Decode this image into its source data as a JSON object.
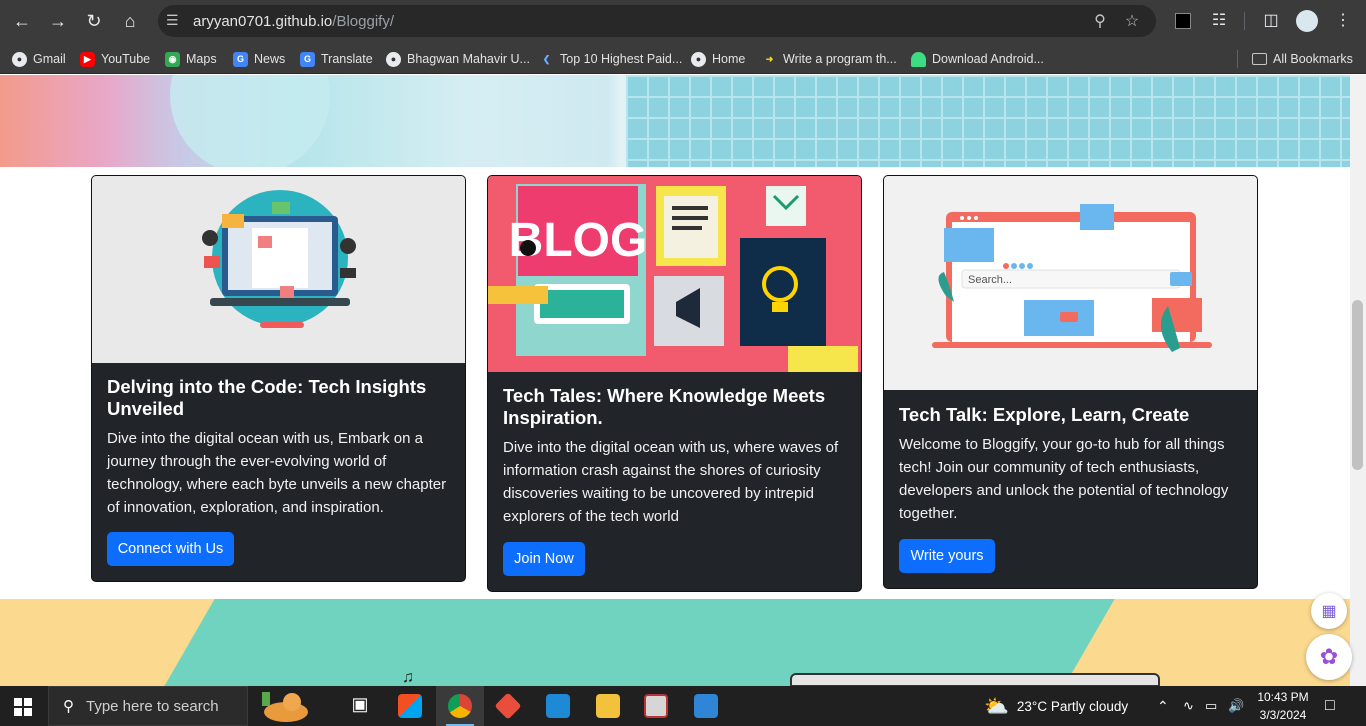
{
  "browser": {
    "url_host": "aryyan0701.github.io",
    "url_path": "/Bloggify/",
    "bookmarks": [
      {
        "label": "Gmail",
        "icon": "globe-icon"
      },
      {
        "label": "YouTube",
        "icon": "youtube-icon"
      },
      {
        "label": "Maps",
        "icon": "maps-icon"
      },
      {
        "label": "News",
        "icon": "news-icon"
      },
      {
        "label": "Translate",
        "icon": "translate-icon"
      },
      {
        "label": "Bhagwan Mahavir U...",
        "icon": "globe-icon"
      },
      {
        "label": "Top 10 Highest Paid...",
        "icon": "bookmark-icon"
      },
      {
        "label": "Home",
        "icon": "globe-icon"
      },
      {
        "label": "Write a program th...",
        "icon": "bolt-icon"
      },
      {
        "label": "Download Android...",
        "icon": "android-icon"
      }
    ],
    "all_bookmarks": "All Bookmarks"
  },
  "cards": [
    {
      "title": "Delving into the Code: Tech Insights Unveiled",
      "text": "Dive into the digital ocean with us, Embark on a journey through the ever-evolving world of technology, where each byte unveils a new chapter of innovation, exploration, and inspiration.",
      "button": "Connect with Us"
    },
    {
      "title": "Tech Tales: Where Knowledge Meets Inspiration.",
      "text": "Dive into the digital ocean with us, where waves of information crash against the shores of curiosity discoveries waiting to be uncovered by intrepid explorers of the tech world",
      "button": "Join Now",
      "image_text": "BLOG"
    },
    {
      "title": "Tech Talk: Explore, Learn, Create",
      "text": "Welcome to Bloggify, your go-to hub for all things tech! Join our community of tech enthusiasts, developers and unlock the potential of technology together.",
      "button": "Write yours",
      "image_search_placeholder": "Search..."
    }
  ],
  "taskbar": {
    "search_placeholder": "Type here to search",
    "weather": "23°C  Partly cloudy",
    "time": "10:43 PM",
    "date": "3/3/2024"
  },
  "colors": {
    "button": "#0d6efd",
    "card_bg": "#212529",
    "chrome_bg": "#3b3b3b"
  }
}
